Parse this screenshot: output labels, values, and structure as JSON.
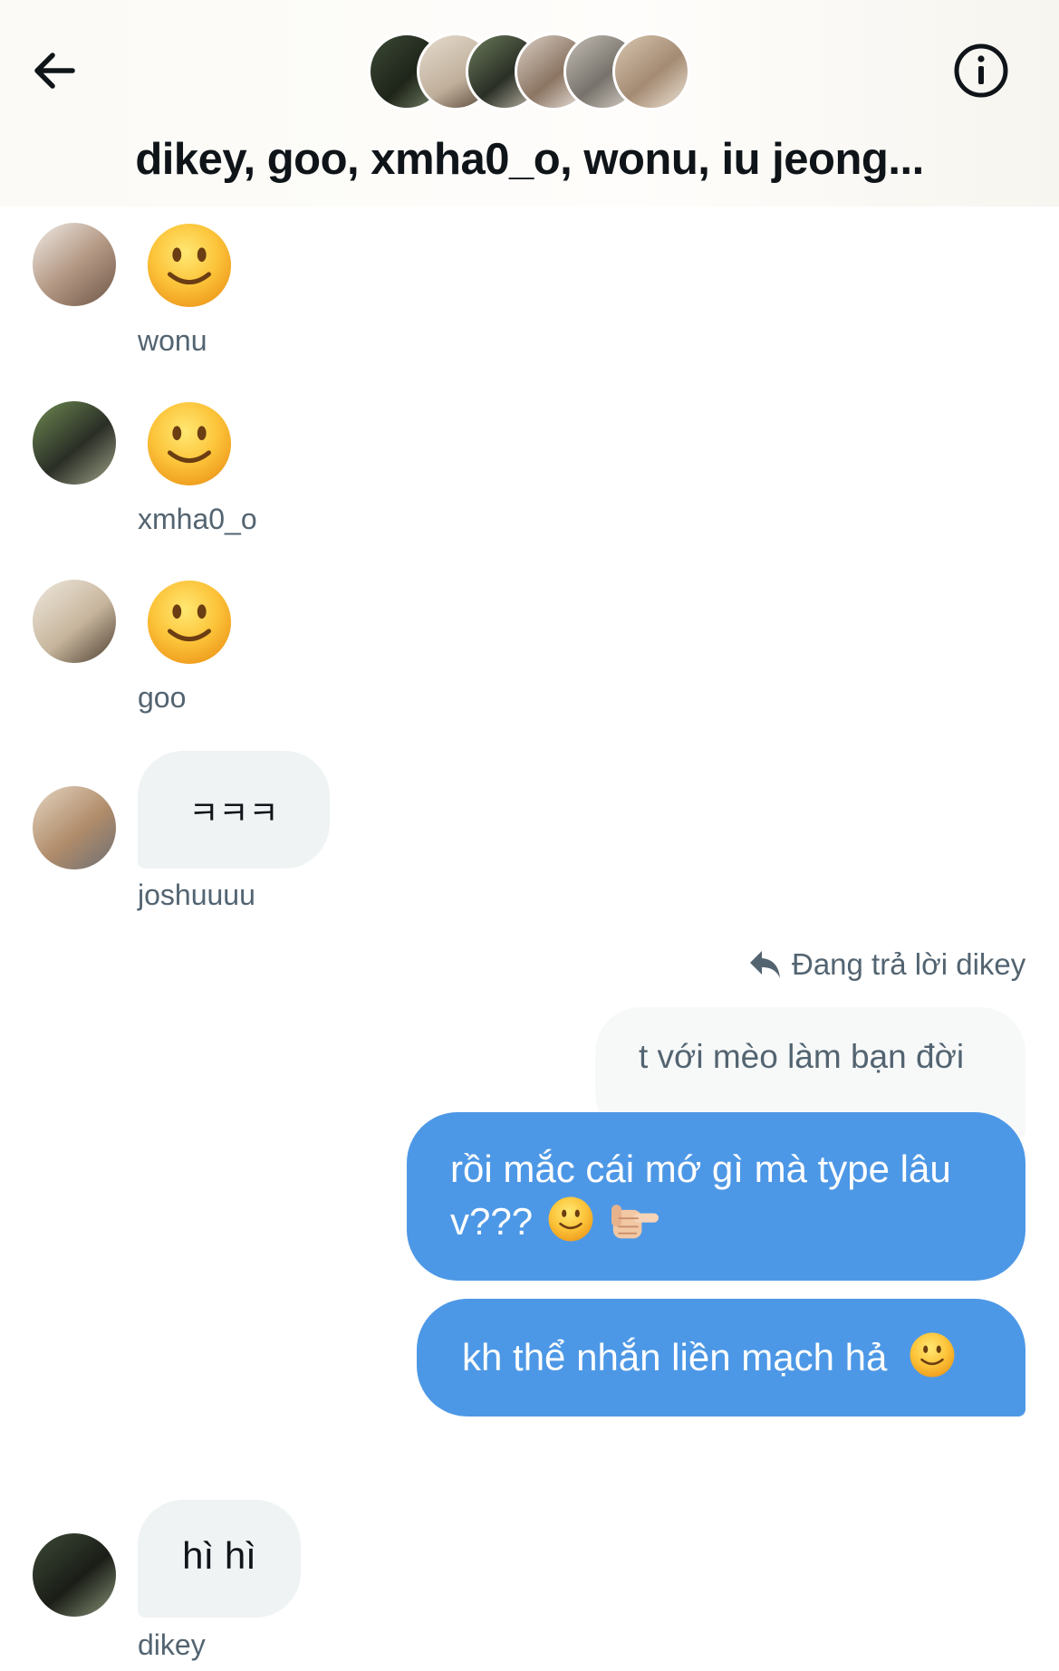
{
  "header": {
    "title": "dikey, goo, xmha0_o, wonu, iu jeong...",
    "back_icon": "arrow-left-icon",
    "info_icon": "info-circle-icon",
    "participants_count_shown": 6
  },
  "messages": [
    {
      "sender": "wonu",
      "type": "emoji",
      "content": "slightly-smiling-face-emoji"
    },
    {
      "sender": "xmha0_o",
      "type": "emoji",
      "content": "slightly-smiling-face-emoji"
    },
    {
      "sender": "goo",
      "type": "emoji",
      "content": "slightly-smiling-face-emoji"
    },
    {
      "sender": "joshuuuu",
      "type": "text",
      "content": "ㅋㅋㅋ"
    },
    {
      "sender": "me",
      "reply_label": "Đang trả lời dikey",
      "quoted_text": "t với mèo làm bạn đời"
    },
    {
      "sender": "me",
      "type": "text",
      "content": "rồi mắc cái mớ gì mà type lâu v???",
      "emojis": [
        "slightly-smiling-face-emoji",
        "pointing-finger-emoji"
      ]
    },
    {
      "sender": "me",
      "type": "text",
      "content": "kh thể nhắn liền mạch hả",
      "emojis": [
        "slightly-smiling-face-emoji"
      ]
    },
    {
      "sender": "dikey",
      "type": "text",
      "content": "hì hì"
    }
  ],
  "colors": {
    "outgoing_bubble": "#4d98e6",
    "incoming_bubble": "#eff3f4",
    "sender_name": "#536471"
  }
}
